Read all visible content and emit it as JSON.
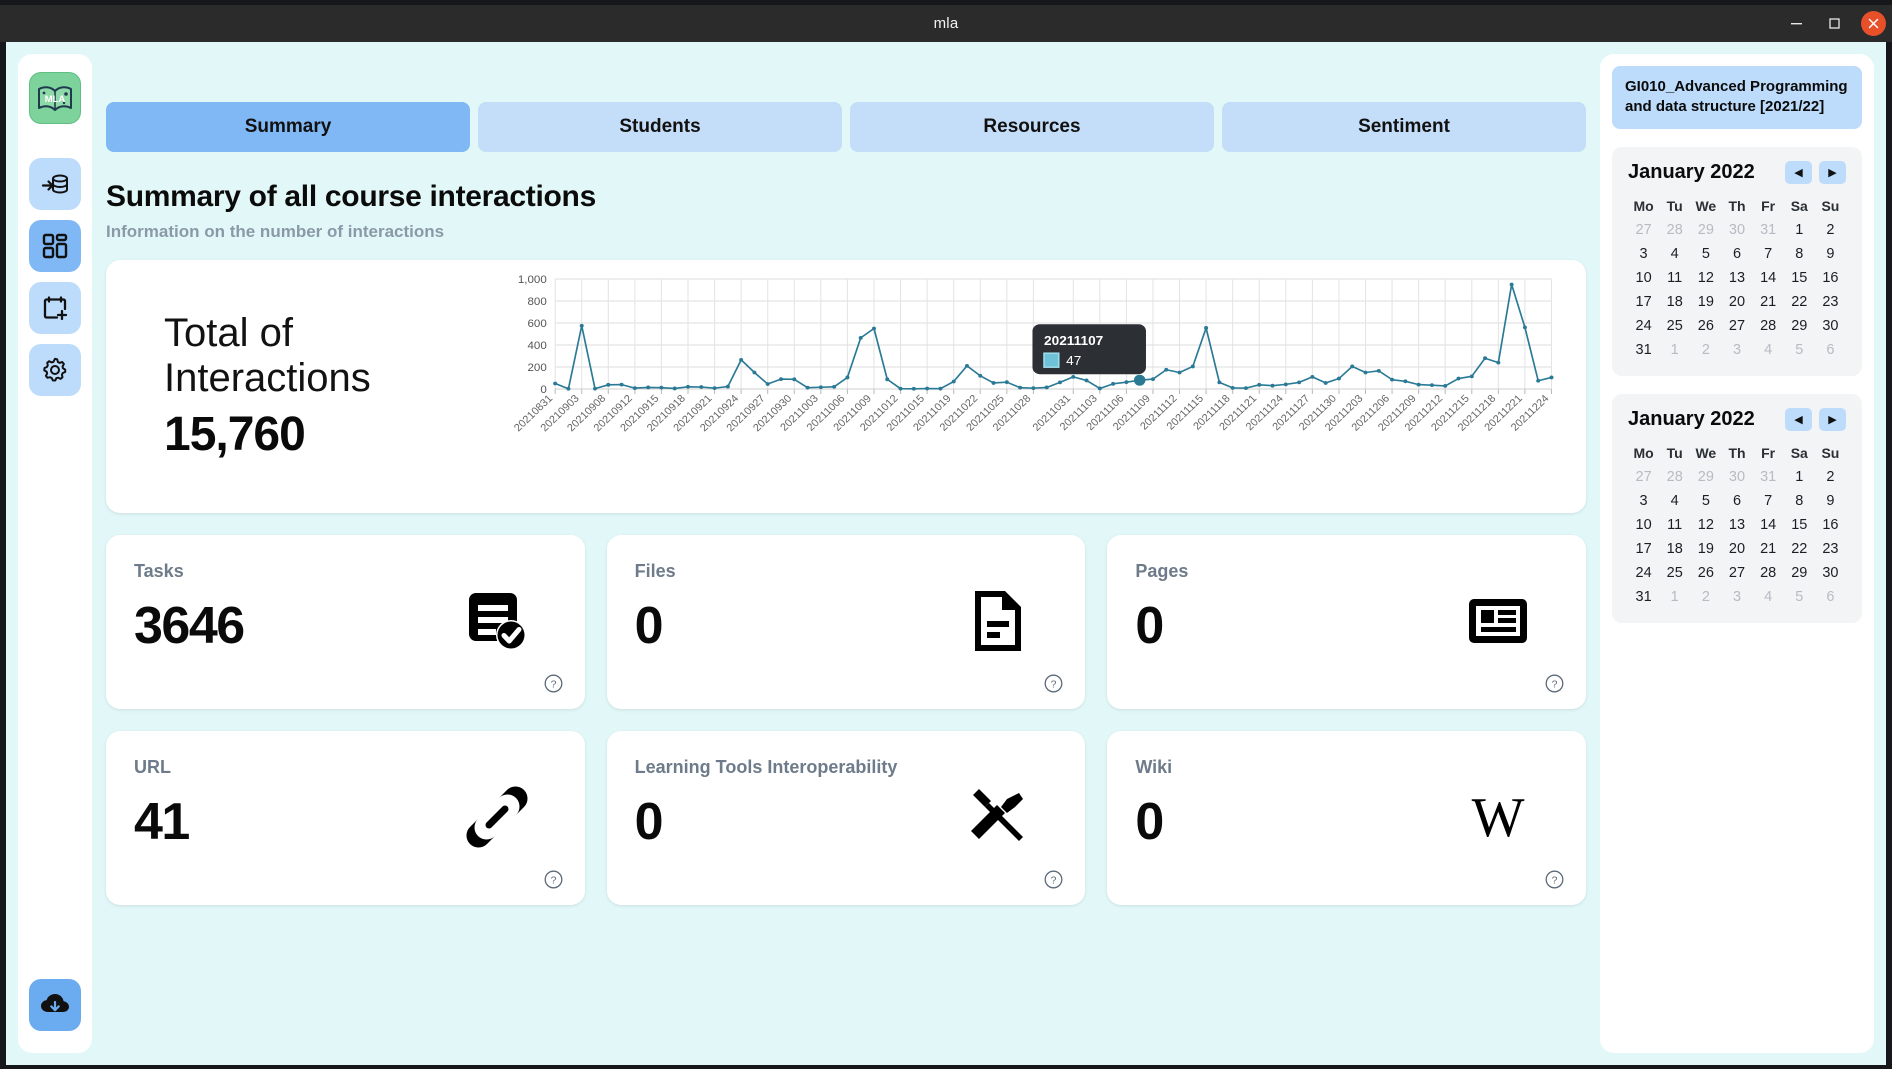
{
  "window": {
    "title": "mla",
    "minimize_label": "–",
    "maximize_label": "❐",
    "close_label": "✕"
  },
  "sidebar": {
    "logo_text": "MLA",
    "items": [
      {
        "name": "database-import",
        "label": "Data import"
      },
      {
        "name": "dashboard",
        "label": "Dashboard",
        "active": true
      },
      {
        "name": "calendar-plus",
        "label": "Calendar"
      },
      {
        "name": "settings",
        "label": "Settings"
      }
    ],
    "bottom": {
      "name": "cloud-download",
      "label": "Download"
    }
  },
  "tabs": [
    {
      "label": "Summary",
      "active": true
    },
    {
      "label": "Students",
      "active": false
    },
    {
      "label": "Resources",
      "active": false
    },
    {
      "label": "Sentiment",
      "active": false
    }
  ],
  "header": {
    "title": "Summary of all course interactions",
    "subtitle": "Information on the number of interactions"
  },
  "hero": {
    "label": "Total of Interactions",
    "value": "15,760"
  },
  "metrics": [
    {
      "label": "Tasks",
      "value": "3646",
      "icon": "tasks-icon",
      "help": "?"
    },
    {
      "label": "Files",
      "value": "0",
      "icon": "file-icon",
      "help": "?"
    },
    {
      "label": "Pages",
      "value": "0",
      "icon": "page-icon",
      "help": "?"
    },
    {
      "label": "URL",
      "value": "41",
      "icon": "link-icon",
      "help": "?"
    },
    {
      "label": "Learning Tools Interoperability",
      "value": "0",
      "icon": "tools-icon",
      "help": "?"
    },
    {
      "label": "Wiki",
      "value": "0",
      "icon": "wiki-icon",
      "help": "?"
    }
  ],
  "right_panel": {
    "course": "GI010_Advanced Programming and data structure [2021/22]",
    "calendars": [
      {
        "title": "January 2022",
        "prev_label": "◀",
        "next_label": "▶",
        "dow": [
          "Mo",
          "Tu",
          "We",
          "Th",
          "Fr",
          "Sa",
          "Su"
        ],
        "weeks": [
          [
            {
              "d": "27",
              "o": true
            },
            {
              "d": "28",
              "o": true
            },
            {
              "d": "29",
              "o": true
            },
            {
              "d": "30",
              "o": true
            },
            {
              "d": "31",
              "o": true
            },
            {
              "d": "1",
              "o": false
            },
            {
              "d": "2",
              "o": false
            }
          ],
          [
            {
              "d": "3",
              "o": false
            },
            {
              "d": "4",
              "o": false
            },
            {
              "d": "5",
              "o": false
            },
            {
              "d": "6",
              "o": false
            },
            {
              "d": "7",
              "o": false
            },
            {
              "d": "8",
              "o": false
            },
            {
              "d": "9",
              "o": false
            }
          ],
          [
            {
              "d": "10",
              "o": false
            },
            {
              "d": "11",
              "o": false
            },
            {
              "d": "12",
              "o": false
            },
            {
              "d": "13",
              "o": false
            },
            {
              "d": "14",
              "o": false
            },
            {
              "d": "15",
              "o": false
            },
            {
              "d": "16",
              "o": false
            }
          ],
          [
            {
              "d": "17",
              "o": false
            },
            {
              "d": "18",
              "o": false
            },
            {
              "d": "19",
              "o": false
            },
            {
              "d": "20",
              "o": false
            },
            {
              "d": "21",
              "o": false
            },
            {
              "d": "22",
              "o": false
            },
            {
              "d": "23",
              "o": false
            }
          ],
          [
            {
              "d": "24",
              "o": false
            },
            {
              "d": "25",
              "o": false
            },
            {
              "d": "26",
              "o": false
            },
            {
              "d": "27",
              "o": false
            },
            {
              "d": "28",
              "o": false
            },
            {
              "d": "29",
              "o": false
            },
            {
              "d": "30",
              "o": false
            }
          ],
          [
            {
              "d": "31",
              "o": false
            },
            {
              "d": "1",
              "o": true
            },
            {
              "d": "2",
              "o": true
            },
            {
              "d": "3",
              "o": true
            },
            {
              "d": "4",
              "o": true
            },
            {
              "d": "5",
              "o": true
            },
            {
              "d": "6",
              "o": true
            }
          ]
        ]
      },
      {
        "title": "January 2022",
        "prev_label": "◀",
        "next_label": "▶",
        "dow": [
          "Mo",
          "Tu",
          "We",
          "Th",
          "Fr",
          "Sa",
          "Su"
        ],
        "weeks": [
          [
            {
              "d": "27",
              "o": true
            },
            {
              "d": "28",
              "o": true
            },
            {
              "d": "29",
              "o": true
            },
            {
              "d": "30",
              "o": true
            },
            {
              "d": "31",
              "o": true
            },
            {
              "d": "1",
              "o": false
            },
            {
              "d": "2",
              "o": false
            }
          ],
          [
            {
              "d": "3",
              "o": false
            },
            {
              "d": "4",
              "o": false
            },
            {
              "d": "5",
              "o": false
            },
            {
              "d": "6",
              "o": false
            },
            {
              "d": "7",
              "o": false
            },
            {
              "d": "8",
              "o": false
            },
            {
              "d": "9",
              "o": false
            }
          ],
          [
            {
              "d": "10",
              "o": false
            },
            {
              "d": "11",
              "o": false
            },
            {
              "d": "12",
              "o": false
            },
            {
              "d": "13",
              "o": false
            },
            {
              "d": "14",
              "o": false
            },
            {
              "d": "15",
              "o": false
            },
            {
              "d": "16",
              "o": false
            }
          ],
          [
            {
              "d": "17",
              "o": false
            },
            {
              "d": "18",
              "o": false
            },
            {
              "d": "19",
              "o": false
            },
            {
              "d": "20",
              "o": false
            },
            {
              "d": "21",
              "o": false
            },
            {
              "d": "22",
              "o": false
            },
            {
              "d": "23",
              "o": false
            }
          ],
          [
            {
              "d": "24",
              "o": false
            },
            {
              "d": "25",
              "o": false
            },
            {
              "d": "26",
              "o": false
            },
            {
              "d": "27",
              "o": false
            },
            {
              "d": "28",
              "o": false
            },
            {
              "d": "29",
              "o": false
            },
            {
              "d": "30",
              "o": false
            }
          ],
          [
            {
              "d": "31",
              "o": false
            },
            {
              "d": "1",
              "o": true
            },
            {
              "d": "2",
              "o": true
            },
            {
              "d": "3",
              "o": true
            },
            {
              "d": "4",
              "o": true
            },
            {
              "d": "5",
              "o": true
            },
            {
              "d": "6",
              "o": true
            }
          ]
        ]
      }
    ]
  },
  "chart_data": {
    "type": "line",
    "title": "",
    "xlabel": "",
    "ylabel": "",
    "ylim": [
      0,
      1000
    ],
    "yticks": [
      0,
      200,
      400,
      600,
      800,
      1000
    ],
    "ytick_labels": [
      "0",
      "200",
      "400",
      "600",
      "800",
      "1,000"
    ],
    "grid": true,
    "legend": "none",
    "line_color": "#2a7a96",
    "marker": "circle",
    "tooltip": {
      "x": "20211107",
      "value": "47",
      "swatch_color": "#6fc3d9"
    },
    "x": [
      "20210831",
      "20210902",
      "20210903",
      "20210905",
      "20210907",
      "20210908",
      "20210910",
      "20210912",
      "20210913",
      "20210915",
      "20210916",
      "20210918",
      "20210920",
      "20210921",
      "20210922",
      "20210924",
      "20210925",
      "20210927",
      "20210928",
      "20210930",
      "20211001",
      "20211003",
      "20211004",
      "20211006",
      "20211007",
      "20211009",
      "20211010",
      "20211012",
      "20211013",
      "20211015",
      "20211017",
      "20211019",
      "20211020",
      "20211022",
      "20211023",
      "20211025",
      "20211026",
      "20211028",
      "20211029",
      "20211031",
      "20211101",
      "20211103",
      "20211104",
      "20211106",
      "20211107",
      "20211109",
      "20211110",
      "20211112",
      "20211113",
      "20211115",
      "20211116",
      "20211118",
      "20211119",
      "20211121",
      "20211122",
      "20211124",
      "20211125",
      "20211127",
      "20211128",
      "20211130",
      "20211201",
      "20211203",
      "20211204",
      "20211206",
      "20211207",
      "20211209",
      "20211210",
      "20211212",
      "20211213",
      "20211215",
      "20211216",
      "20211218",
      "20211219",
      "20211221",
      "20211222",
      "20211224"
    ],
    "tick_labels": [
      "20210831",
      "20210903",
      "20210908",
      "20210912",
      "20210915",
      "20210918",
      "20210921",
      "20210924",
      "20210927",
      "20210930",
      "20211003",
      "20211006",
      "20211009",
      "20211012",
      "20211015",
      "20211019",
      "20211022",
      "20211025",
      "20211028",
      "20211031",
      "20211103",
      "20211106",
      "20211109",
      "20211112",
      "20211115",
      "20211118",
      "20211121",
      "20211124",
      "20211127",
      "20211130",
      "20211203",
      "20211206",
      "20211209",
      "20211212",
      "20211215",
      "20211218",
      "20211221",
      "20211224"
    ],
    "values": [
      50,
      2,
      575,
      3,
      38,
      40,
      8,
      14,
      12,
      5,
      20,
      18,
      8,
      22,
      265,
      150,
      45,
      90,
      88,
      12,
      16,
      20,
      105,
      465,
      550,
      88,
      3,
      2,
      4,
      3,
      68,
      210,
      120,
      55,
      62,
      12,
      8,
      14,
      60,
      110,
      78,
      5,
      47,
      62,
      80,
      90,
      175,
      150,
      205,
      555,
      60,
      10,
      8,
      38,
      30,
      42,
      60,
      110,
      55,
      95,
      205,
      150,
      165,
      85,
      70,
      40,
      35,
      28,
      95,
      115,
      280,
      240,
      950,
      560,
      75,
      105
    ],
    "series": [
      {
        "name": "Interactions",
        "color": "#2a7a96"
      }
    ]
  }
}
